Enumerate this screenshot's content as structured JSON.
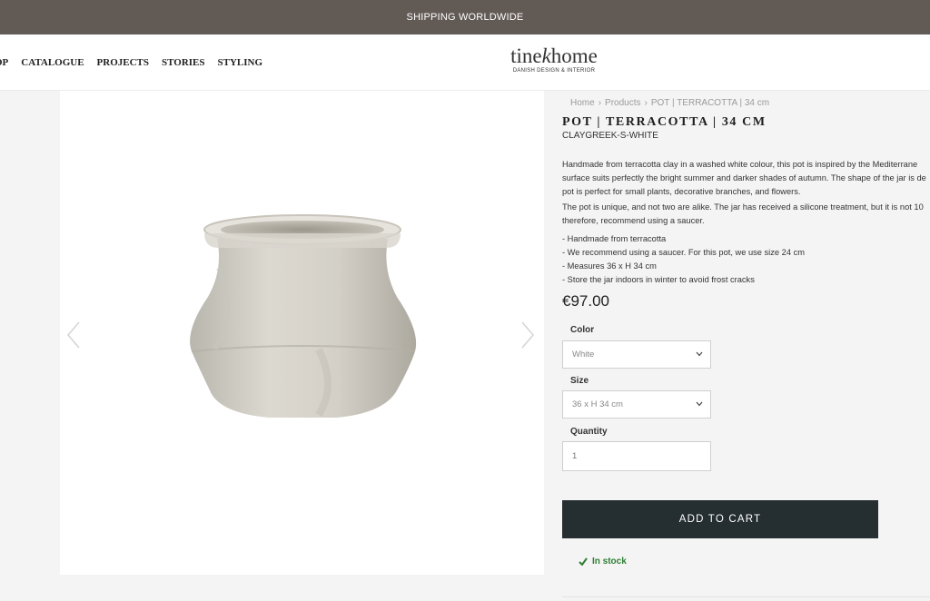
{
  "announcement": "SHIPPING WORLDWIDE",
  "nav": [
    "OP",
    "CATALOGUE",
    "PROJECTS",
    "STORIES",
    "STYLING"
  ],
  "logo": {
    "name_a": "tine",
    "name_k": "k",
    "name_b": "home",
    "tagline": "DANISH DESIGN & INTERIOR"
  },
  "breadcrumb": [
    "Home",
    "Products",
    "POT | TERRACOTTA | 34 cm"
  ],
  "product": {
    "title": "POT | TERRACOTTA | 34 CM",
    "sku": "CLAYGREEK-S-WHITE",
    "description": [
      "Handmade from terracotta clay in a washed white colour, this pot is inspired by the Mediterrane",
      "surface suits perfectly the bright summer and darker shades of autumn. The shape of the jar is de",
      "pot is perfect for small plants, decorative branches, and flowers."
    ],
    "description2": [
      "The pot is unique, and not two are alike. The jar has received a silicone treatment, but it is not 10",
      "therefore, recommend using a saucer."
    ],
    "bullets": [
      "- Handmade from terracotta",
      "- We recommend using a saucer. For this pot, we use size 24 cm",
      "- Measures 36 x H 34 cm",
      "- Store the jar indoors in winter to avoid frost cracks"
    ],
    "price": "€97.00"
  },
  "options": {
    "color_label": "Color",
    "color_value": "White",
    "size_label": "Size",
    "size_value": "36 x H 34 cm",
    "quantity_label": "Quantity",
    "quantity_value": "1"
  },
  "add_to_cart": "ADD TO CART",
  "stock": "In stock",
  "colors": {
    "topbar": "#625a55",
    "button": "#252e30",
    "in_stock": "#2e7d32"
  }
}
